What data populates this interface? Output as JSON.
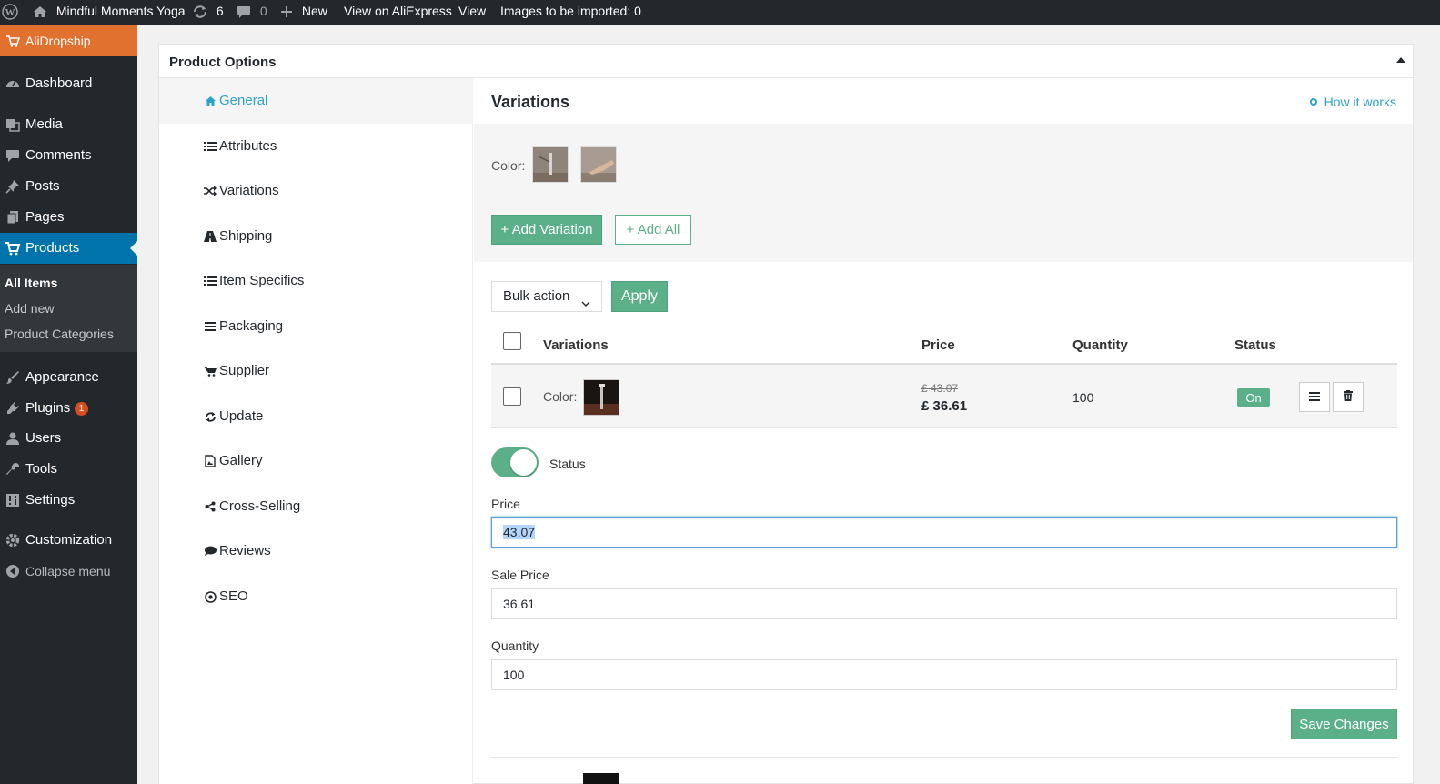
{
  "adminbar": {
    "site_name": "Mindful Moments Yoga",
    "updates_count": "6",
    "comments_count": "0",
    "new_label": "New",
    "view_aliexpress": "View on AliExpress",
    "view": "View",
    "images_import": "Images to be imported: 0"
  },
  "sidebar": {
    "alidropship": "AliDropship",
    "items": [
      {
        "label": "Dashboard",
        "icon": "dashboard-icon"
      },
      {
        "label": "Media",
        "icon": "media-icon"
      },
      {
        "label": "Comments",
        "icon": "comments-icon"
      },
      {
        "label": "Posts",
        "icon": "pin-icon"
      },
      {
        "label": "Pages",
        "icon": "pages-icon"
      },
      {
        "label": "Products",
        "icon": "cart-icon"
      },
      {
        "label": "Appearance",
        "icon": "brush-icon"
      },
      {
        "label": "Plugins",
        "icon": "plug-icon",
        "badge": "1"
      },
      {
        "label": "Users",
        "icon": "user-icon"
      },
      {
        "label": "Tools",
        "icon": "wrench-icon"
      },
      {
        "label": "Settings",
        "icon": "settings-icon"
      },
      {
        "label": "Customization",
        "icon": "gear-icon"
      }
    ],
    "submenu": [
      "All Items",
      "Add new",
      "Product Categories"
    ],
    "collapse": "Collapse menu"
  },
  "panel": {
    "title": "Product Options",
    "tabs": [
      "General",
      "Attributes",
      "Variations",
      "Shipping",
      "Item Specifics",
      "Packaging",
      "Supplier",
      "Update",
      "Gallery",
      "Cross-Selling",
      "Reviews",
      "SEO"
    ]
  },
  "variations": {
    "title": "Variations",
    "how_it_works": "How it works",
    "color_label": "Color:",
    "add_variation": "+ Add Variation",
    "add_all": "+ Add All",
    "bulk_action": "Bulk action",
    "apply": "Apply",
    "columns": {
      "variations": "Variations",
      "price": "Price",
      "quantity": "Quantity",
      "status": "Status"
    },
    "row": {
      "color_label": "Color:",
      "old_price": "£ 43.07",
      "price": "£ 36.61",
      "quantity": "100",
      "status": "On"
    },
    "form": {
      "status_label": "Status",
      "price_label": "Price",
      "price_value": "43.07",
      "sale_price_label": "Sale Price",
      "sale_price_value": "36.61",
      "quantity_label": "Quantity",
      "quantity_value": "100",
      "save": "Save Changes"
    }
  }
}
